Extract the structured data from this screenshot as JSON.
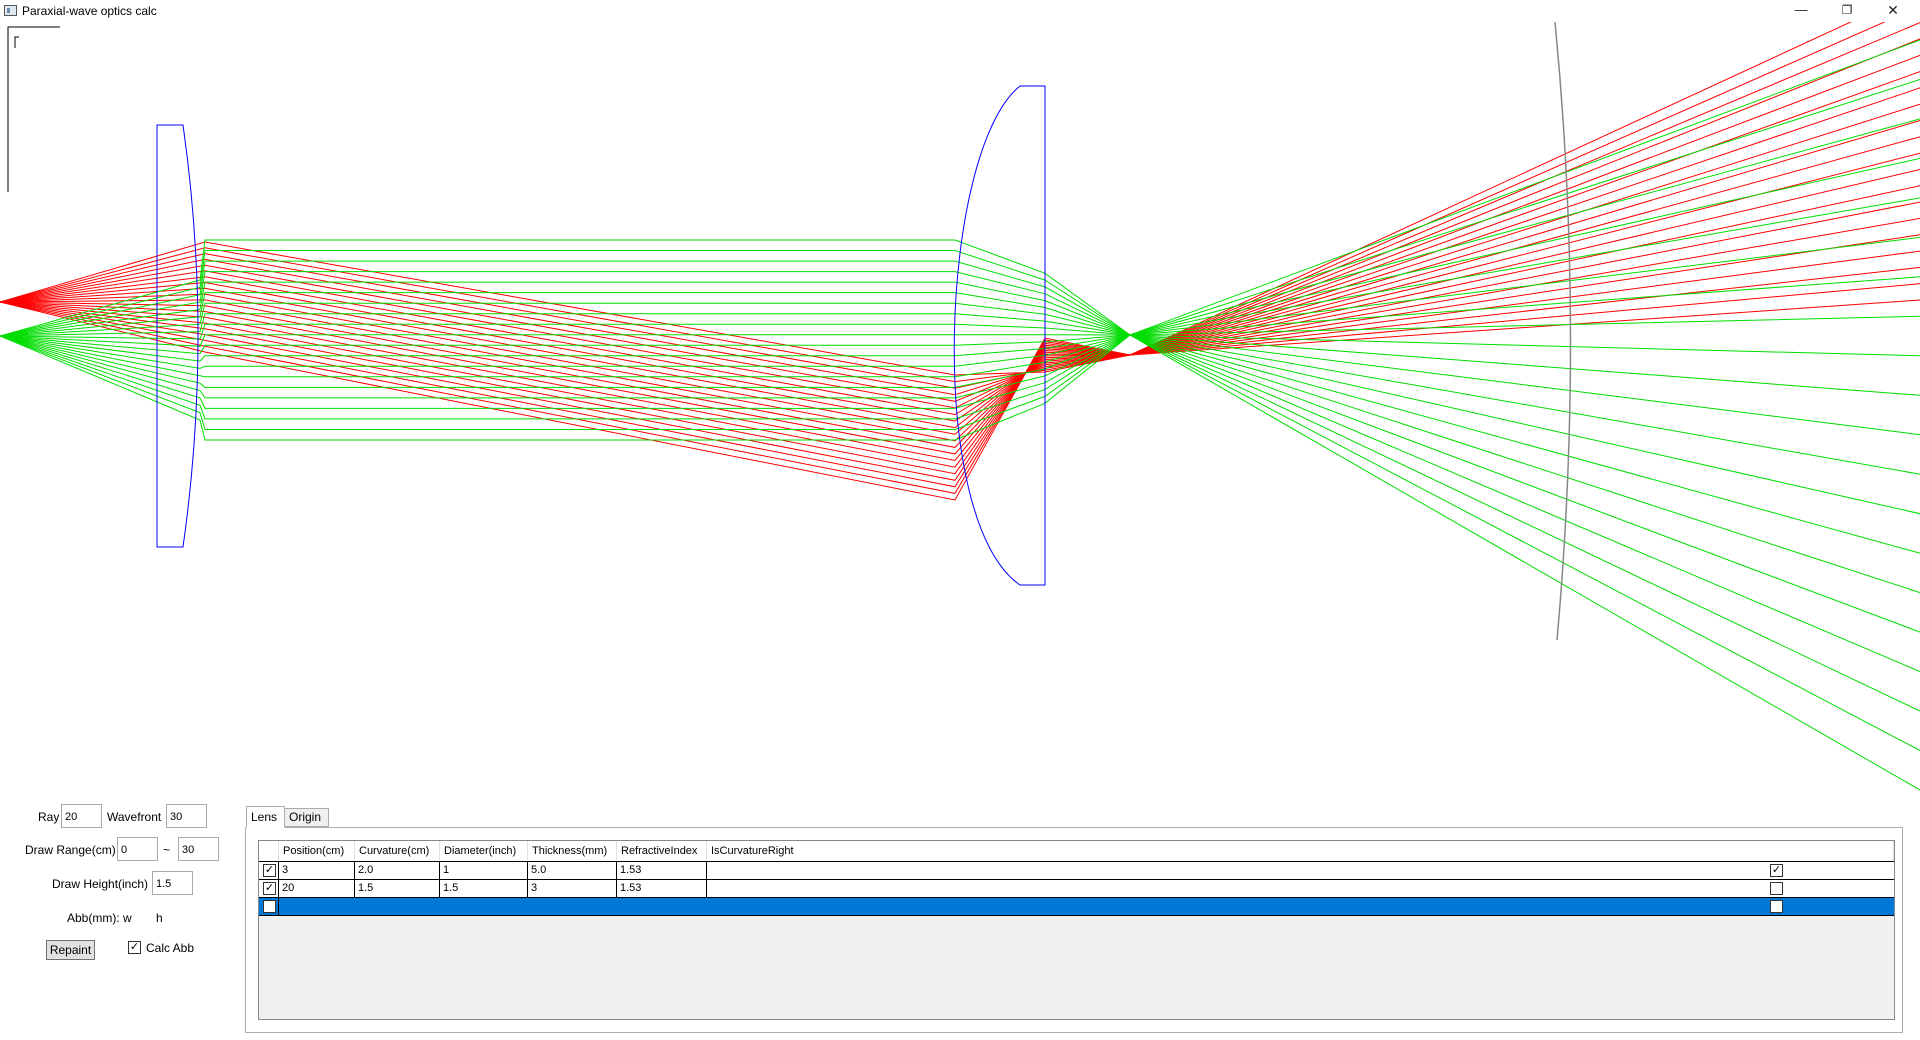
{
  "window": {
    "title": "Paraxial-wave optics calc",
    "min_glyph": "—",
    "max_glyph": "❐",
    "close_glyph": "✕"
  },
  "canvas": {
    "colors": {
      "ray_a": "#ff0000",
      "ray_b": "#00dd00",
      "lens": "#0000ff",
      "frame": "#000000",
      "screen": "#888888"
    }
  },
  "controls": {
    "ray_label": "Ray",
    "ray_value": "20",
    "wavefront_label": "Wavefront",
    "wavefront_value": "30",
    "draw_range_label": "Draw Range(cm)",
    "draw_range_from": "0",
    "draw_range_sep": "~",
    "draw_range_to": "30",
    "draw_height_label": "Draw Height(inch)",
    "draw_height_value": "1.5",
    "abb_label": "Abb(mm): w",
    "abb_h_label": "h",
    "repaint_label": "Repaint",
    "calc_abb_label": "Calc Abb",
    "calc_abb_checked": true
  },
  "tabs": [
    {
      "label": "Lens",
      "active": true
    },
    {
      "label": "Origin",
      "active": false
    }
  ],
  "grid": {
    "columns": [
      "Position(cm)",
      "Curvature(cm)",
      "Diameter(inch)",
      "Thickness(mm)",
      "RefractiveIndex",
      "IsCurvatureRight"
    ],
    "rows": [
      {
        "enabled": true,
        "position": "3",
        "curvature": "2.0",
        "diameter": "1",
        "thickness": "5.0",
        "refractive_index": "1.53",
        "is_curvature_right": true,
        "selected": false
      },
      {
        "enabled": true,
        "position": "20",
        "curvature": "1.5",
        "diameter": "1.5",
        "thickness": "3",
        "refractive_index": "1.53",
        "is_curvature_right": false,
        "selected": false
      },
      {
        "enabled": false,
        "position": "",
        "curvature": "",
        "diameter": "",
        "thickness": "",
        "refractive_index": "",
        "is_curvature_right": false,
        "selected": true
      }
    ]
  }
}
